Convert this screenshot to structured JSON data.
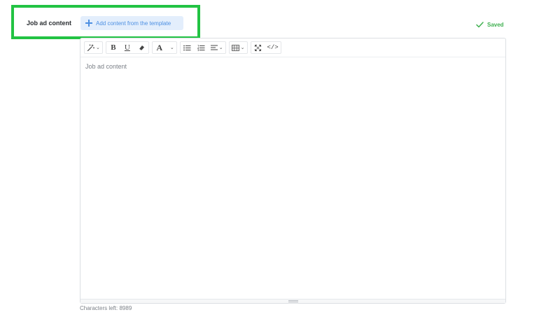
{
  "field": {
    "label": "Job ad content",
    "add_template_label": "Add content from the template"
  },
  "status": {
    "saved_label": "Saved",
    "color": "#3fb050"
  },
  "editor": {
    "placeholder": "Job ad content",
    "toolbar": {
      "bold": "B",
      "underline": "U",
      "font_color": "A",
      "code": "</>"
    }
  },
  "footer": {
    "chars_left": "Characters left: 8989"
  },
  "colors": {
    "highlight": "#22c343",
    "accent": "#4c8fe2",
    "accent_bg": "#e3eefc"
  }
}
